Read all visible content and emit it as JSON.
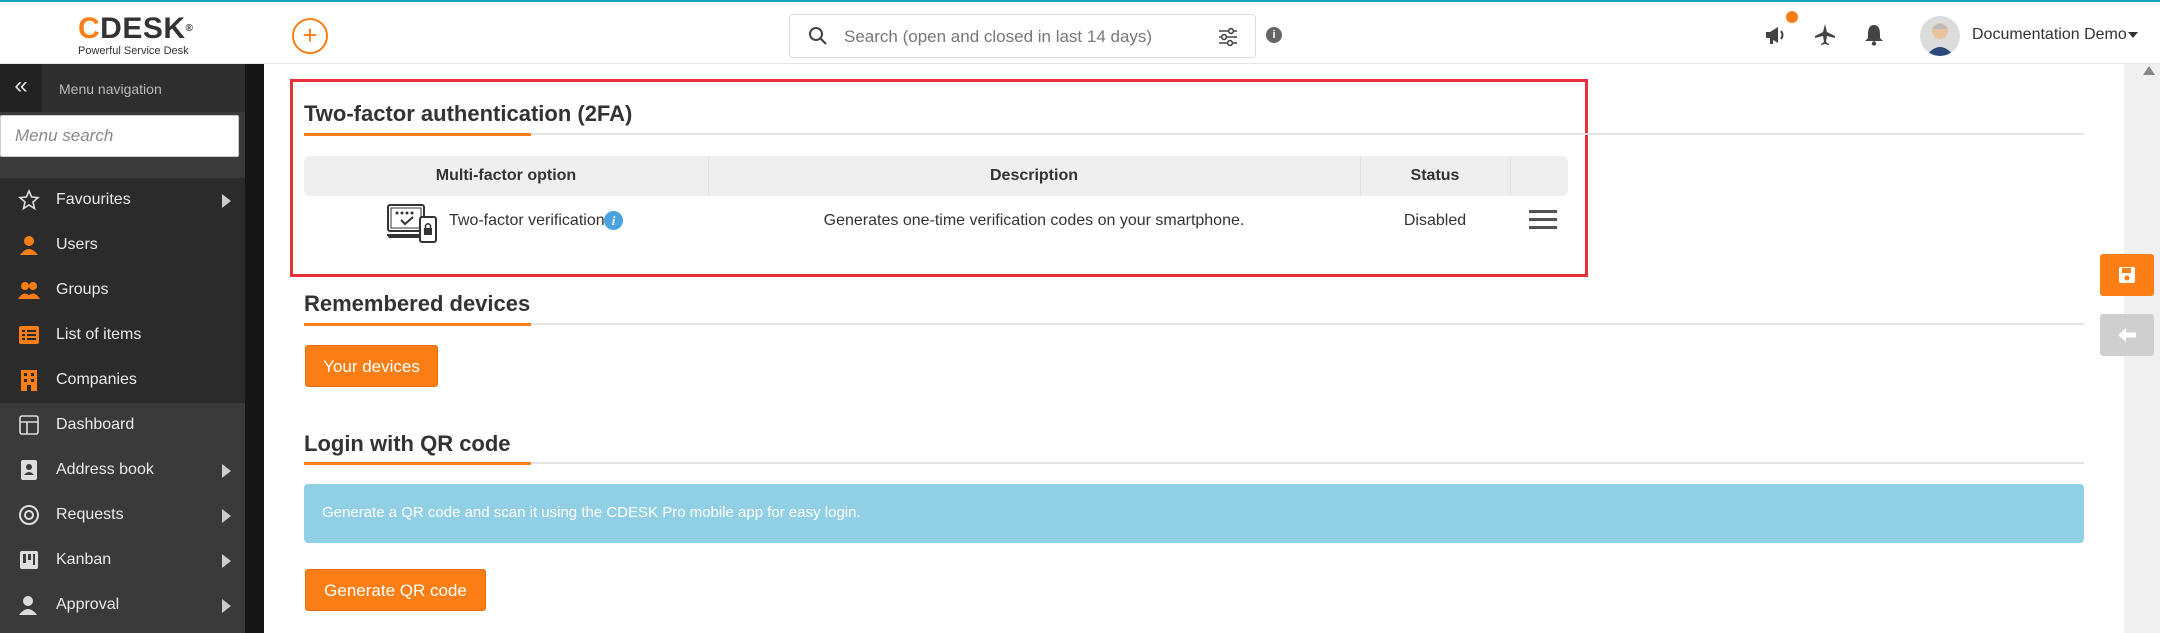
{
  "header": {
    "logo_text": "CDESK",
    "logo_tagline": "Powerful Service Desk",
    "search_placeholder": "Search (open and closed in last 14 days)",
    "user_name": "Documentation Demo",
    "icons": [
      "add-icon",
      "search-icon",
      "filter-icon",
      "info-icon",
      "megaphone-icon",
      "airplane-icon",
      "bell-icon",
      "avatar"
    ],
    "accent_color": "#fd7e14"
  },
  "sidebar": {
    "menu_nav_label": "Menu navigation",
    "menu_search_placeholder": "Menu search",
    "items": [
      {
        "label": "Favourites",
        "icon": "star-icon",
        "has_submenu": true
      },
      {
        "label": "Users",
        "icon": "user-icon",
        "has_submenu": false
      },
      {
        "label": "Groups",
        "icon": "group-icon",
        "has_submenu": false
      },
      {
        "label": "List of items",
        "icon": "list-icon",
        "has_submenu": false
      },
      {
        "label": "Companies",
        "icon": "building-icon",
        "has_submenu": false
      },
      {
        "label": "Dashboard",
        "icon": "dashboard-icon",
        "has_submenu": false
      },
      {
        "label": "Address book",
        "icon": "address-book-icon",
        "has_submenu": true
      },
      {
        "label": "Requests",
        "icon": "requests-icon",
        "has_submenu": true
      },
      {
        "label": "Kanban",
        "icon": "kanban-icon",
        "has_submenu": true
      },
      {
        "label": "Approval",
        "icon": "approval-icon",
        "has_submenu": true
      }
    ]
  },
  "tfa": {
    "title": "Two-factor authentication (2FA)",
    "columns": [
      "Multi-factor option",
      "Description",
      "Status"
    ],
    "rows": [
      {
        "option": "Two-factor verification",
        "description": "Generates one-time verification codes on your smartphone.",
        "status": "Disabled"
      }
    ]
  },
  "remembered": {
    "title": "Remembered devices",
    "button": "Your devices"
  },
  "qr": {
    "title": "Login with QR code",
    "info": "Generate a QR code and scan it using the CDESK Pro mobile app for easy login.",
    "button": "Generate QR code"
  }
}
